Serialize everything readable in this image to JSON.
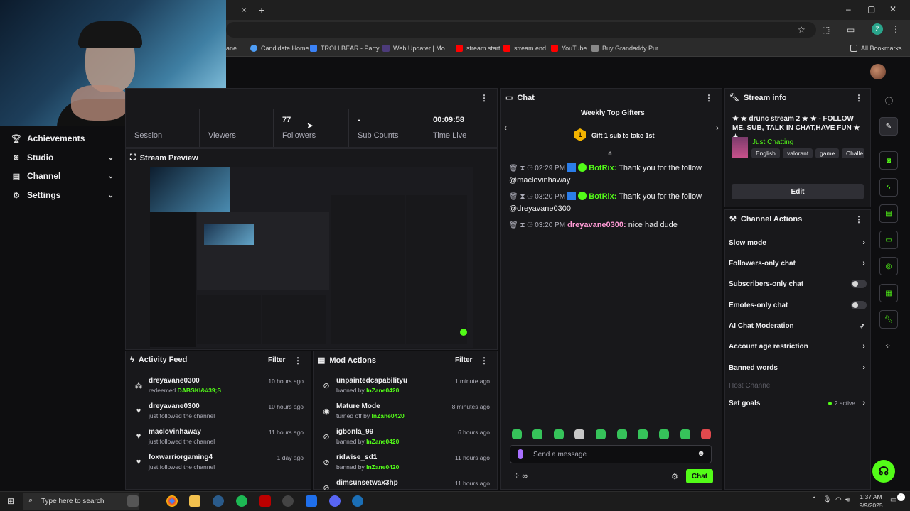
{
  "browser": {
    "close_tab": "×",
    "new_tab": "+",
    "bookmarks": [
      {
        "label": "ane...",
        "color": "#7a7a7a"
      },
      {
        "label": "Candidate Home",
        "color": "#4e9df5"
      },
      {
        "label": "TROLI BEAR - Party...",
        "color": "#3b82f6"
      },
      {
        "label": "Web Updater | Mo...",
        "color": "#8b5cf6"
      },
      {
        "label": "stream start",
        "color": "#ff0000"
      },
      {
        "label": "stream end",
        "color": "#ff0000"
      },
      {
        "label": "YouTube",
        "color": "#ff0000"
      },
      {
        "label": "Buy Grandaddy Pur...",
        "color": "#888888"
      }
    ],
    "all_bookmarks": "All Bookmarks",
    "profile_letter": "Z"
  },
  "sidebar": {
    "items": [
      {
        "label": "Achievements",
        "icon": "trophy-icon"
      },
      {
        "label": "Studio",
        "icon": "studio-icon"
      },
      {
        "label": "Channel",
        "icon": "channel-icon"
      },
      {
        "label": "Settings",
        "icon": "gear-icon"
      }
    ]
  },
  "stats": {
    "session_label": "Session",
    "viewers_label": "Viewers",
    "followers_value": "77",
    "followers_label": "Followers",
    "subs_value": "-",
    "subs_label": "Sub Counts",
    "time_value": "00:09:58",
    "time_label": "Time Live"
  },
  "preview": {
    "title": "Stream Preview"
  },
  "activity": {
    "title": "Activity Feed",
    "filter": "Filter",
    "rows": [
      {
        "who": "dreyavane0300",
        "what": "redeemed",
        "highlight": "DABSKI&#39;S",
        "when": "10 hours ago",
        "icon": "redeem-icon"
      },
      {
        "who": "dreyavane0300",
        "what": "just followed the channel",
        "highlight": "",
        "when": "10 hours ago",
        "icon": "heart-icon"
      },
      {
        "who": "maclovinhaway",
        "what": "just followed the channel",
        "highlight": "",
        "when": "11 hours ago",
        "icon": "heart-icon"
      },
      {
        "who": "foxwarriorgaming4",
        "what": "just followed the channel",
        "highlight": "",
        "when": "1 day ago",
        "icon": "heart-icon"
      }
    ]
  },
  "mod_actions": {
    "title": "Mod Actions",
    "filter": "Filter",
    "rows": [
      {
        "who": "unpaintedcapabilityu",
        "what": "banned by",
        "highlight": "InZane0420",
        "when": "1 minute ago",
        "icon": "ban-icon"
      },
      {
        "who": "Mature Mode",
        "what": "turned off by",
        "highlight": "InZane0420",
        "when": "8 minutes ago",
        "icon": "eye-icon"
      },
      {
        "who": "igbonla_99",
        "what": "banned by",
        "highlight": "InZane0420",
        "when": "6 hours ago",
        "icon": "ban-icon"
      },
      {
        "who": "ridwise_sd1",
        "what": "banned by",
        "highlight": "InZane0420",
        "when": "11 hours ago",
        "icon": "ban-icon"
      },
      {
        "who": "dimsunsetwax3hp",
        "what": "",
        "highlight": "",
        "when": "11 hours ago",
        "icon": "ban-icon"
      }
    ]
  },
  "chat": {
    "title": "Chat",
    "gifters_title": "Weekly Top Gifters",
    "gift_rank": "1",
    "gift_text": "Gift 1 sub to take 1st",
    "messages": [
      {
        "time": "02:29 PM",
        "user": "BotRix:",
        "text": " Thank you for the follow @maclovinhaway",
        "bot": true
      },
      {
        "time": "03:20 PM",
        "user": "BotRix:",
        "text": " Thank you for the follow @dreyavane0300",
        "bot": true
      },
      {
        "time": "03:20 PM",
        "user": "dreyavane0300:",
        "text": " nice had dude",
        "bot": false
      }
    ],
    "input_placeholder": "Send a message",
    "send_label": "Chat"
  },
  "stream_info": {
    "title": "Stream info",
    "stream_title": "★ ★ drunc stream 2 ★ ★ - FOLLOW ME, SUB, TALK IN CHAT,HAVE FUN ★ ★",
    "category": "Just Chatting",
    "tags": [
      "English",
      "valorant",
      "game",
      "Challe"
    ],
    "edit_label": "Edit"
  },
  "channel_actions": {
    "title": "Channel Actions",
    "rows": [
      {
        "label": "Slow mode",
        "control": "chevron"
      },
      {
        "label": "Followers-only chat",
        "control": "chevron"
      },
      {
        "label": "Subscribers-only chat",
        "control": "toggle"
      },
      {
        "label": "Emotes-only chat",
        "control": "toggle"
      },
      {
        "label": "AI Chat Moderation",
        "control": "external"
      },
      {
        "label": "Account age restriction",
        "control": "chevron"
      },
      {
        "label": "Banned words",
        "control": "chevron"
      },
      {
        "label": "Host Channel",
        "control": "none"
      },
      {
        "label": "Set goals",
        "control": "chevron"
      }
    ],
    "goals_status": "2 active"
  },
  "taskbar": {
    "search_placeholder": "Type here to search",
    "time": "1:37 AM",
    "date": "9/9/2025",
    "notification_count": "1"
  },
  "colors": {
    "accent": "#53fc18",
    "panel": "#18181b",
    "bg": "#0e0e10"
  }
}
